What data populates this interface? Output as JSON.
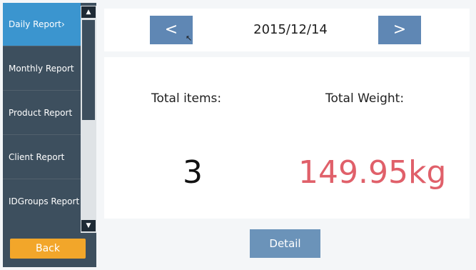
{
  "sidebar": {
    "items": [
      {
        "label": "Daily Report",
        "arrow": "›"
      },
      {
        "label": "Monthly Report"
      },
      {
        "label": "Product Report"
      },
      {
        "label": "Client Report"
      },
      {
        "label": "IDGroups Report"
      }
    ],
    "active_index": 0,
    "back_label": "Back"
  },
  "scrollbar": {
    "up_icon": "▲",
    "down_icon": "▼"
  },
  "header": {
    "prev_label": "<",
    "date": "2015/12/14",
    "next_label": ">"
  },
  "summary": {
    "items_label": "Total items:",
    "items_value": "3",
    "weight_label": "Total Weight:",
    "weight_value": "149.95kg"
  },
  "detail_label": "Detail",
  "colors": {
    "sidebar_bg": "#3d4f5e",
    "active_item": "#3b95cf",
    "back_button": "#f2a62a",
    "nav_button": "#5f87b4",
    "detail_button": "#6b93b9",
    "weight_value": "#e0606a"
  },
  "icons": {
    "cursor": "mouse-pointer-icon"
  }
}
